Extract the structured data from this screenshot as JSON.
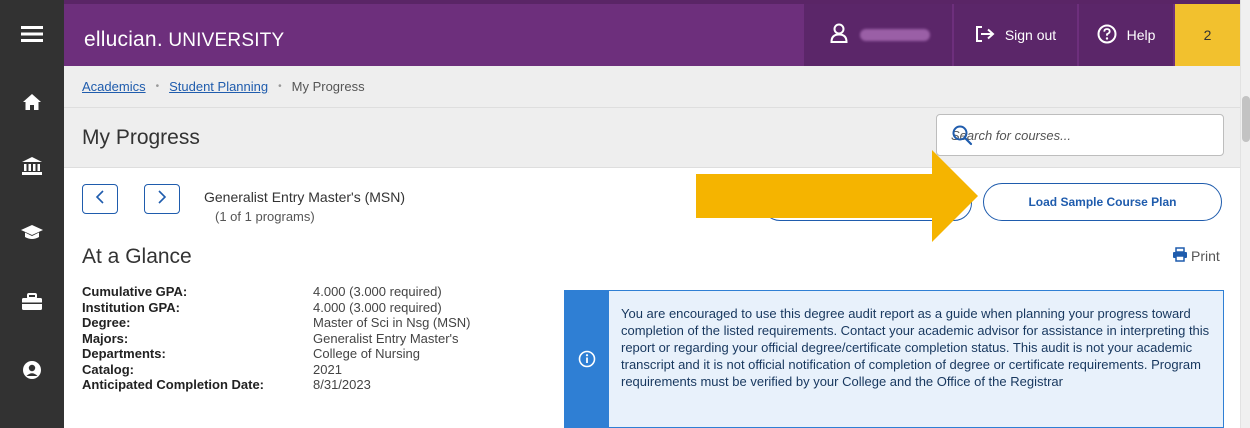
{
  "app": {
    "brand_main": "ellucian.",
    "brand_sub": " UNIVERSITY",
    "sign_out": "Sign out",
    "help": "Help",
    "badge_count": "2"
  },
  "breadcrumb": {
    "items": [
      "Academics",
      "Student Planning",
      "My Progress"
    ]
  },
  "page": {
    "title": "My Progress",
    "search_placeholder": "Search for courses..."
  },
  "program": {
    "name": "Generalist Entry Master's (MSN)",
    "count": "(1 of 1 programs)",
    "load_button": "Load Sample Course Plan"
  },
  "glance": {
    "title": "At a Glance",
    "print": "Print",
    "facts": [
      {
        "label": "Cumulative GPA:",
        "value": "4.000 (3.000 required)"
      },
      {
        "label": "Institution GPA:",
        "value": "4.000 (3.000 required)"
      },
      {
        "label": "Degree:",
        "value": "Master of Sci in Nsg (MSN)"
      },
      {
        "label": "Majors:",
        "value": "Generalist Entry Master's"
      },
      {
        "label": "Departments:",
        "value": "College of Nursing"
      },
      {
        "label": "Catalog:",
        "value": "2021"
      },
      {
        "label": "Anticipated Completion Date:",
        "value": "8/31/2023"
      }
    ]
  },
  "notice": {
    "text": "You are encouraged to use this degree audit report as a guide when planning your progress toward completion of the listed requirements. Contact your academic advisor for assistance in interpreting this report or regarding your official degree/certificate completion status. This audit is not your academic transcript and it is not official notification of completion of degree or certificate requirements. Program requirements must be verified by your College and the Office of the Registrar"
  },
  "colors": {
    "brand_purple": "#6d2f7c",
    "accent_yellow": "#f2c12e",
    "link_blue": "#1f5cad",
    "info_blue": "#2f7fd4",
    "annotation_arrow": "#f5b400"
  },
  "icons": [
    "menu-icon",
    "home-icon",
    "institution-icon",
    "graduation-cap-icon",
    "briefcase-icon",
    "user-circle-icon",
    "user-icon",
    "sign-out-icon",
    "help-icon",
    "search-icon",
    "chevron-left-icon",
    "chevron-right-icon",
    "print-icon",
    "info-icon"
  ]
}
